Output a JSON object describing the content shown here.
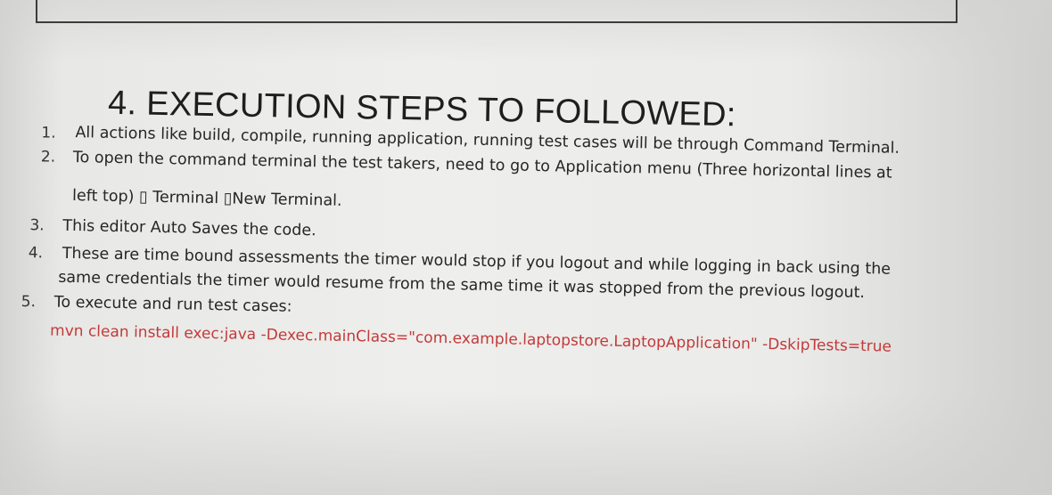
{
  "heading": "4. EXECUTION STEPS TO FOLLOWED:",
  "steps": [
    {
      "number": "1.",
      "lines": [
        "All actions like build, compile, running application, running test cases will be through Command Terminal."
      ]
    },
    {
      "number": "2.",
      "lines": [
        "To open the command terminal the test takers, need to go to Application menu (Three horizontal lines at",
        "left top) ▯ Terminal ▯New Terminal."
      ]
    },
    {
      "number": "3.",
      "lines": [
        "This editor Auto Saves the code."
      ]
    },
    {
      "number": "4.",
      "lines": [
        "These are time bound assessments the timer would stop if you logout and while logging in back using the",
        "same credentials the timer would resume from the same time it was stopped from the previous logout."
      ]
    },
    {
      "number": "5.",
      "lines": [
        "To execute and run test cases:"
      ]
    }
  ],
  "command": "mvn clean install exec:java -Dexec.mainClass=\"com.example.laptopstore.LaptopApplication\" -DskipTests=true",
  "colors": {
    "command_text": "#c23a3a",
    "body_text": "#262626"
  }
}
